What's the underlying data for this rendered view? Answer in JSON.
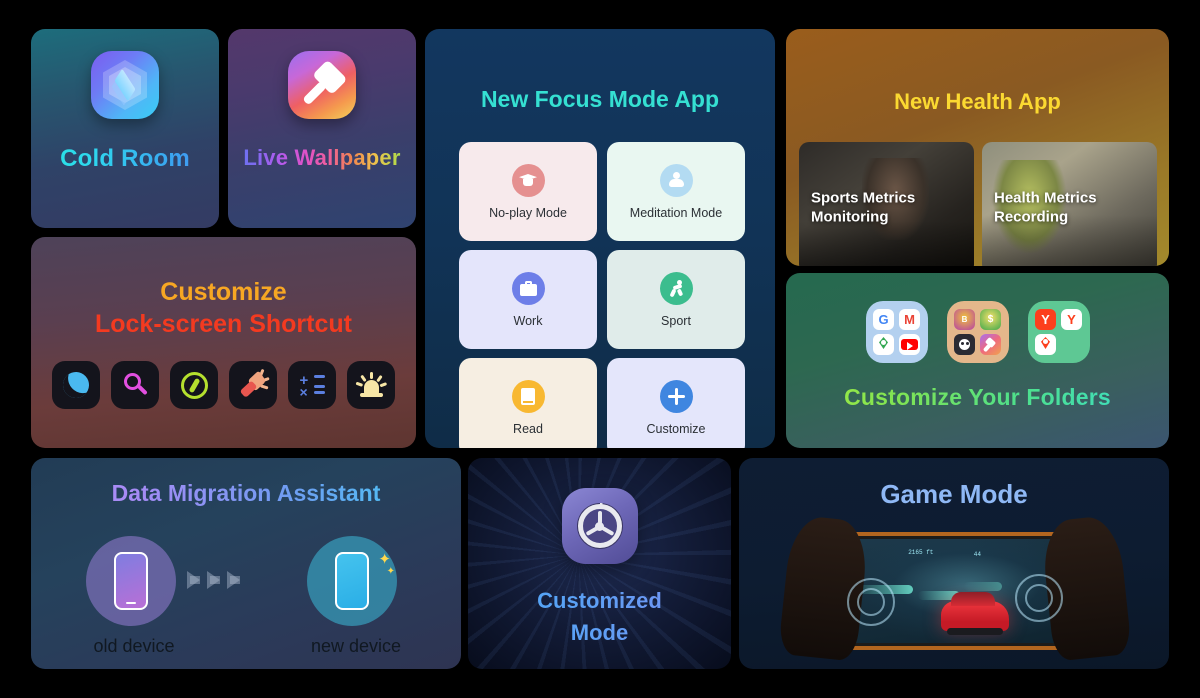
{
  "cards": {
    "cold_room": {
      "title": "Cold Room",
      "icon": "cube-hexagon-icon"
    },
    "live_wallpaper": {
      "title": "Live Wallpaper",
      "icon": "paint-brush-icon"
    },
    "lock_screen": {
      "title_line1": "Customize",
      "title_line2": "Lock-screen Shortcut",
      "accent_line1": "#f7a723",
      "accent_line2": "#f33a20",
      "shortcuts": [
        {
          "name": "do-not-disturb-moon-icon",
          "label": "Do Not Disturb",
          "color": "#4ab9ef"
        },
        {
          "name": "search-magnifier-icon",
          "label": "Search",
          "color": "#e24fe0"
        },
        {
          "name": "compass-icon",
          "label": "Compass",
          "color": "#b5e02e"
        },
        {
          "name": "flashlight-icon",
          "label": "Flashlight",
          "color": "#e8564f"
        },
        {
          "name": "calculator-icon",
          "label": "Calculator",
          "color": "#5b7fe0"
        },
        {
          "name": "siren-alarm-icon",
          "label": "Alarm",
          "color": "#f7e6a6"
        }
      ]
    },
    "focus_mode": {
      "title": "New Focus Mode App",
      "title_color": "#35e0d2",
      "tiles": [
        {
          "label": "No-play Mode",
          "icon": "graduation-cap-icon",
          "tile_color": "#f7eaec",
          "circle_color": "#e59090"
        },
        {
          "label": "Meditation Mode",
          "icon": "meditation-person-icon",
          "tile_color": "#e9f7f1",
          "circle_color": "#b3dbf2"
        },
        {
          "label": "Work",
          "icon": "briefcase-icon",
          "tile_color": "#e4e5fb",
          "circle_color": "#6d7ee8"
        },
        {
          "label": "Sport",
          "icon": "running-person-icon",
          "tile_color": "#e0ecea",
          "circle_color": "#3cbd8e"
        },
        {
          "label": "Read",
          "icon": "book-icon",
          "tile_color": "#f6eee2",
          "circle_color": "#f8b831"
        },
        {
          "label": "Customize",
          "icon": "plus-icon",
          "tile_color": "#e4e6fb",
          "circle_color": "#3f86e0"
        }
      ]
    },
    "health": {
      "title": "New Health App",
      "title_color": "#fbd931",
      "photos": [
        {
          "caption_line1": "Sports Metrics",
          "caption_line2": "Monitoring",
          "name": "sports-metrics-photo"
        },
        {
          "caption_line1": "Health Metrics",
          "caption_line2": "Recording",
          "name": "health-metrics-photo"
        }
      ]
    },
    "folders": {
      "title": "Customize Your Folders",
      "groups": [
        {
          "name": "google-folder",
          "bg": "#b3d0ef",
          "apps": [
            "google-icon",
            "gmail-icon",
            "google-maps-icon",
            "youtube-icon"
          ]
        },
        {
          "name": "games-folder",
          "bg": "#e4b78b",
          "apps": [
            "bingo-game-icon",
            "coin-game-icon",
            "dog-game-icon",
            "live-wallpaper-icon"
          ]
        },
        {
          "name": "yandex-folder",
          "bg": "#5ec894",
          "apps": [
            "yandex-browser-icon",
            "yandex-app-icon",
            "yandex-maps-icon"
          ]
        }
      ]
    },
    "migration": {
      "title": "Data Migration Assistant",
      "old_label": "old device",
      "new_label": "new device",
      "arrow_count": 3
    },
    "customized_mode": {
      "title_line1": "Customized",
      "title_line2": "Mode",
      "icon": "gear-settings-icon"
    },
    "game_mode": {
      "title": "Game Mode",
      "title_color": "#8fb8f5",
      "hud_left": "2165 ft",
      "hud_right": "44"
    }
  }
}
